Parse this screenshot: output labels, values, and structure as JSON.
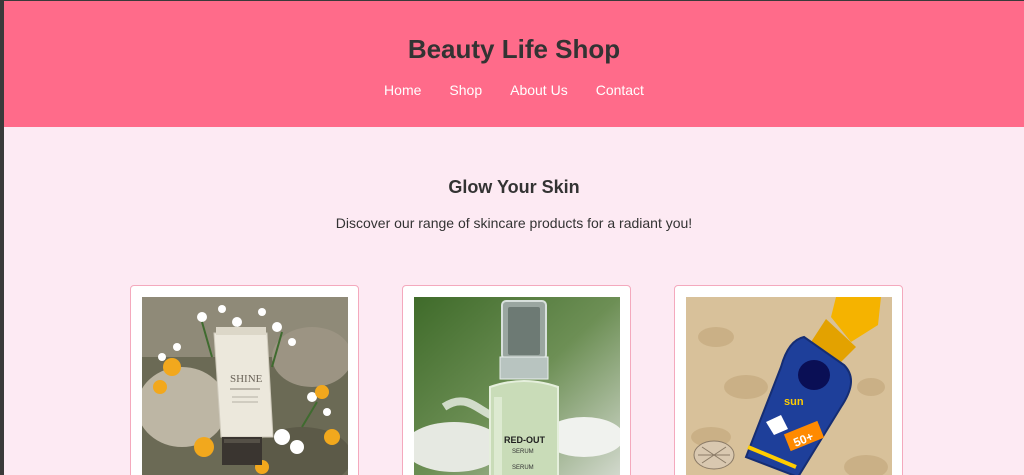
{
  "header": {
    "title": "Beauty Life Shop",
    "nav": [
      "Home",
      "Shop",
      "About Us",
      "Contact"
    ],
    "background": "#ff6b8a"
  },
  "hero": {
    "title": "Glow Your Skin",
    "subtitle": "Discover our range of skincare products for a radiant you!"
  },
  "products": [
    {
      "image": "shine-cream-tube-with-flowers",
      "brand_text": "SHINE"
    },
    {
      "image": "red-out-serum-bottle",
      "brand_text": "RED-OUT SERUM"
    },
    {
      "image": "sun-spf-lotion-bottle-on-sand",
      "brand_text": "sun 50+"
    }
  ],
  "colors": {
    "page_background": "#fdeaf3",
    "card_border": "#f4a9bd",
    "text": "#333333"
  }
}
